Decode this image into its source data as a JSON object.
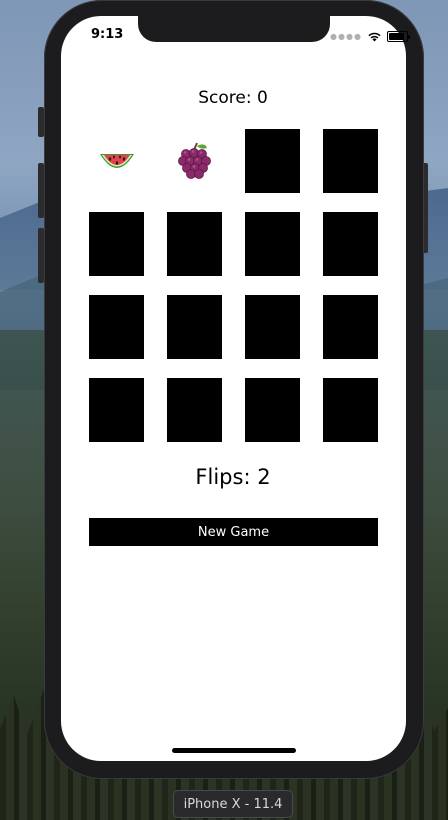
{
  "status_bar": {
    "time": "9:13"
  },
  "game": {
    "score_label": "Score: 0",
    "flips_label": "Flips: 2",
    "new_game_label": "New Game",
    "cards": [
      {
        "face_up": true,
        "emoji": "watermelon"
      },
      {
        "face_up": true,
        "emoji": "grapes"
      },
      {
        "face_up": false
      },
      {
        "face_up": false
      },
      {
        "face_up": false
      },
      {
        "face_up": false
      },
      {
        "face_up": false
      },
      {
        "face_up": false
      },
      {
        "face_up": false
      },
      {
        "face_up": false
      },
      {
        "face_up": false
      },
      {
        "face_up": false
      },
      {
        "face_up": false
      },
      {
        "face_up": false
      },
      {
        "face_up": false
      },
      {
        "face_up": false
      }
    ]
  },
  "simulator": {
    "device_label": "iPhone X - 11.4"
  },
  "colors": {
    "card_back": "#000000",
    "screen_bg": "#ffffff",
    "button_bg": "#000000",
    "button_text": "#ffffff"
  }
}
